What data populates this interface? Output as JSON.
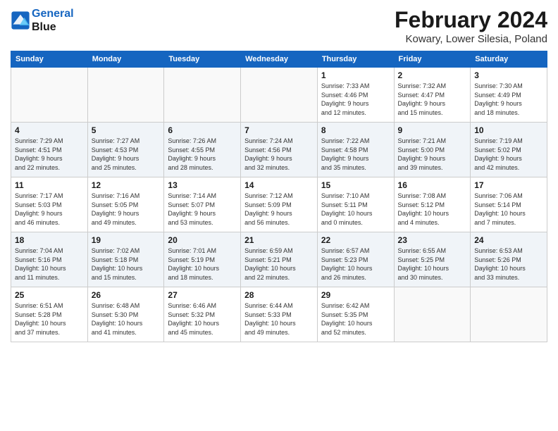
{
  "logo": {
    "line1": "General",
    "line2": "Blue"
  },
  "title": "February 2024",
  "location": "Kowary, Lower Silesia, Poland",
  "days_of_week": [
    "Sunday",
    "Monday",
    "Tuesday",
    "Wednesday",
    "Thursday",
    "Friday",
    "Saturday"
  ],
  "weeks": [
    {
      "shaded": false,
      "days": [
        {
          "num": "",
          "info": ""
        },
        {
          "num": "",
          "info": ""
        },
        {
          "num": "",
          "info": ""
        },
        {
          "num": "",
          "info": ""
        },
        {
          "num": "1",
          "info": "Sunrise: 7:33 AM\nSunset: 4:46 PM\nDaylight: 9 hours\nand 12 minutes."
        },
        {
          "num": "2",
          "info": "Sunrise: 7:32 AM\nSunset: 4:47 PM\nDaylight: 9 hours\nand 15 minutes."
        },
        {
          "num": "3",
          "info": "Sunrise: 7:30 AM\nSunset: 4:49 PM\nDaylight: 9 hours\nand 18 minutes."
        }
      ]
    },
    {
      "shaded": true,
      "days": [
        {
          "num": "4",
          "info": "Sunrise: 7:29 AM\nSunset: 4:51 PM\nDaylight: 9 hours\nand 22 minutes."
        },
        {
          "num": "5",
          "info": "Sunrise: 7:27 AM\nSunset: 4:53 PM\nDaylight: 9 hours\nand 25 minutes."
        },
        {
          "num": "6",
          "info": "Sunrise: 7:26 AM\nSunset: 4:55 PM\nDaylight: 9 hours\nand 28 minutes."
        },
        {
          "num": "7",
          "info": "Sunrise: 7:24 AM\nSunset: 4:56 PM\nDaylight: 9 hours\nand 32 minutes."
        },
        {
          "num": "8",
          "info": "Sunrise: 7:22 AM\nSunset: 4:58 PM\nDaylight: 9 hours\nand 35 minutes."
        },
        {
          "num": "9",
          "info": "Sunrise: 7:21 AM\nSunset: 5:00 PM\nDaylight: 9 hours\nand 39 minutes."
        },
        {
          "num": "10",
          "info": "Sunrise: 7:19 AM\nSunset: 5:02 PM\nDaylight: 9 hours\nand 42 minutes."
        }
      ]
    },
    {
      "shaded": false,
      "days": [
        {
          "num": "11",
          "info": "Sunrise: 7:17 AM\nSunset: 5:03 PM\nDaylight: 9 hours\nand 46 minutes."
        },
        {
          "num": "12",
          "info": "Sunrise: 7:16 AM\nSunset: 5:05 PM\nDaylight: 9 hours\nand 49 minutes."
        },
        {
          "num": "13",
          "info": "Sunrise: 7:14 AM\nSunset: 5:07 PM\nDaylight: 9 hours\nand 53 minutes."
        },
        {
          "num": "14",
          "info": "Sunrise: 7:12 AM\nSunset: 5:09 PM\nDaylight: 9 hours\nand 56 minutes."
        },
        {
          "num": "15",
          "info": "Sunrise: 7:10 AM\nSunset: 5:11 PM\nDaylight: 10 hours\nand 0 minutes."
        },
        {
          "num": "16",
          "info": "Sunrise: 7:08 AM\nSunset: 5:12 PM\nDaylight: 10 hours\nand 4 minutes."
        },
        {
          "num": "17",
          "info": "Sunrise: 7:06 AM\nSunset: 5:14 PM\nDaylight: 10 hours\nand 7 minutes."
        }
      ]
    },
    {
      "shaded": true,
      "days": [
        {
          "num": "18",
          "info": "Sunrise: 7:04 AM\nSunset: 5:16 PM\nDaylight: 10 hours\nand 11 minutes."
        },
        {
          "num": "19",
          "info": "Sunrise: 7:02 AM\nSunset: 5:18 PM\nDaylight: 10 hours\nand 15 minutes."
        },
        {
          "num": "20",
          "info": "Sunrise: 7:01 AM\nSunset: 5:19 PM\nDaylight: 10 hours\nand 18 minutes."
        },
        {
          "num": "21",
          "info": "Sunrise: 6:59 AM\nSunset: 5:21 PM\nDaylight: 10 hours\nand 22 minutes."
        },
        {
          "num": "22",
          "info": "Sunrise: 6:57 AM\nSunset: 5:23 PM\nDaylight: 10 hours\nand 26 minutes."
        },
        {
          "num": "23",
          "info": "Sunrise: 6:55 AM\nSunset: 5:25 PM\nDaylight: 10 hours\nand 30 minutes."
        },
        {
          "num": "24",
          "info": "Sunrise: 6:53 AM\nSunset: 5:26 PM\nDaylight: 10 hours\nand 33 minutes."
        }
      ]
    },
    {
      "shaded": false,
      "days": [
        {
          "num": "25",
          "info": "Sunrise: 6:51 AM\nSunset: 5:28 PM\nDaylight: 10 hours\nand 37 minutes."
        },
        {
          "num": "26",
          "info": "Sunrise: 6:48 AM\nSunset: 5:30 PM\nDaylight: 10 hours\nand 41 minutes."
        },
        {
          "num": "27",
          "info": "Sunrise: 6:46 AM\nSunset: 5:32 PM\nDaylight: 10 hours\nand 45 minutes."
        },
        {
          "num": "28",
          "info": "Sunrise: 6:44 AM\nSunset: 5:33 PM\nDaylight: 10 hours\nand 49 minutes."
        },
        {
          "num": "29",
          "info": "Sunrise: 6:42 AM\nSunset: 5:35 PM\nDaylight: 10 hours\nand 52 minutes."
        },
        {
          "num": "",
          "info": ""
        },
        {
          "num": "",
          "info": ""
        }
      ]
    }
  ]
}
